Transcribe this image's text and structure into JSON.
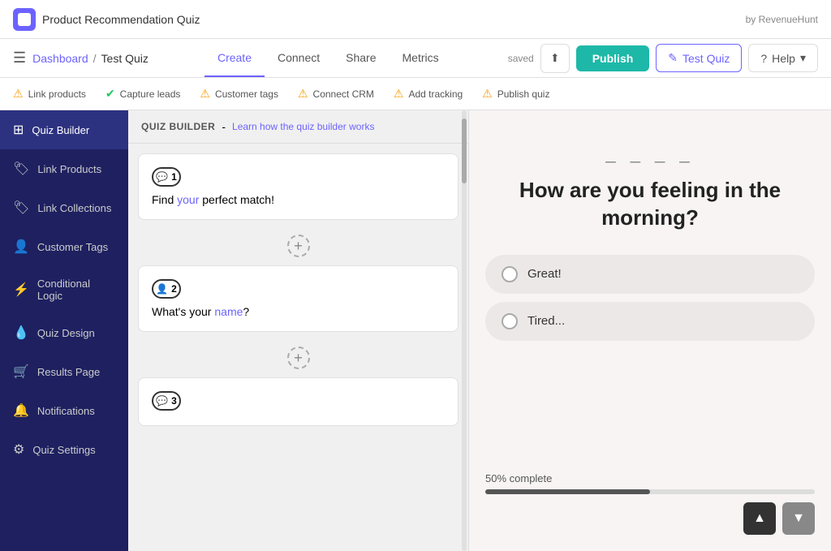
{
  "app": {
    "title": "Product Recommendation Quiz",
    "by_label": "by RevenueHunt"
  },
  "nav": {
    "hamburger": "☰",
    "dashboard_label": "Dashboard",
    "breadcrumb_sep": "/",
    "test_quiz_label": "Test Quiz",
    "saved_label": "saved",
    "publish_label": "Publish",
    "test_quiz_btn_label": "Test Quiz",
    "help_btn_label": "Help",
    "tabs": [
      {
        "id": "create",
        "label": "Create",
        "active": true
      },
      {
        "id": "connect",
        "label": "Connect",
        "active": false
      },
      {
        "id": "share",
        "label": "Share",
        "active": false
      },
      {
        "id": "metrics",
        "label": "Metrics",
        "active": false
      }
    ]
  },
  "progress_steps": [
    {
      "id": "link-products",
      "label": "Link products",
      "status": "warning"
    },
    {
      "id": "capture-leads",
      "label": "Capture leads",
      "status": "ok"
    },
    {
      "id": "customer-tags",
      "label": "Customer tags",
      "status": "warning"
    },
    {
      "id": "connect-crm",
      "label": "Connect CRM",
      "status": "warning"
    },
    {
      "id": "add-tracking",
      "label": "Add tracking",
      "status": "warning"
    },
    {
      "id": "publish-quiz",
      "label": "Publish quiz",
      "status": "warning"
    }
  ],
  "sidebar": {
    "items": [
      {
        "id": "quiz-builder",
        "label": "Quiz Builder",
        "icon": "⊞",
        "active": true
      },
      {
        "id": "link-products",
        "label": "Link Products",
        "icon": "🏷",
        "active": false
      },
      {
        "id": "link-collections",
        "label": "Link Collections",
        "icon": "🏷",
        "active": false
      },
      {
        "id": "customer-tags",
        "label": "Customer Tags",
        "icon": "👤",
        "active": false
      },
      {
        "id": "conditional-logic",
        "label": "Conditional Logic",
        "icon": "⚡",
        "active": false
      },
      {
        "id": "quiz-design",
        "label": "Quiz Design",
        "icon": "💧",
        "active": false
      },
      {
        "id": "results-page",
        "label": "Results Page",
        "icon": "🛒",
        "active": false
      },
      {
        "id": "notifications",
        "label": "Notifications",
        "icon": "🔔",
        "active": false
      },
      {
        "id": "quiz-settings",
        "label": "Quiz Settings",
        "icon": "⚙",
        "active": false
      }
    ]
  },
  "quiz_builder": {
    "title": "QUIZ BUILDER",
    "separator": "-",
    "learn_link": "Learn how the quiz builder works",
    "questions": [
      {
        "id": 1,
        "badge_icon": "💬",
        "badge_num": "1",
        "text_before": "Find ",
        "text_highlight1": "your",
        "text_middle": " perfect match",
        "text_highlight2": "!",
        "full_text": "Find your perfect match!"
      },
      {
        "id": 2,
        "badge_icon": "👤",
        "badge_num": "2",
        "text_before": "What's your ",
        "text_highlight1": "name",
        "text_after": "?",
        "full_text": "What's your name?"
      },
      {
        "id": 3,
        "badge_icon": "💬",
        "badge_num": "3",
        "full_text": ""
      }
    ]
  },
  "preview": {
    "underlines": "_ _ _ _",
    "question": "How are you feeling in the morning?",
    "options": [
      {
        "id": "great",
        "label": "Great!"
      },
      {
        "id": "tired",
        "label": "Tired..."
      }
    ],
    "progress_label": "50% complete",
    "progress_percent": 50
  }
}
